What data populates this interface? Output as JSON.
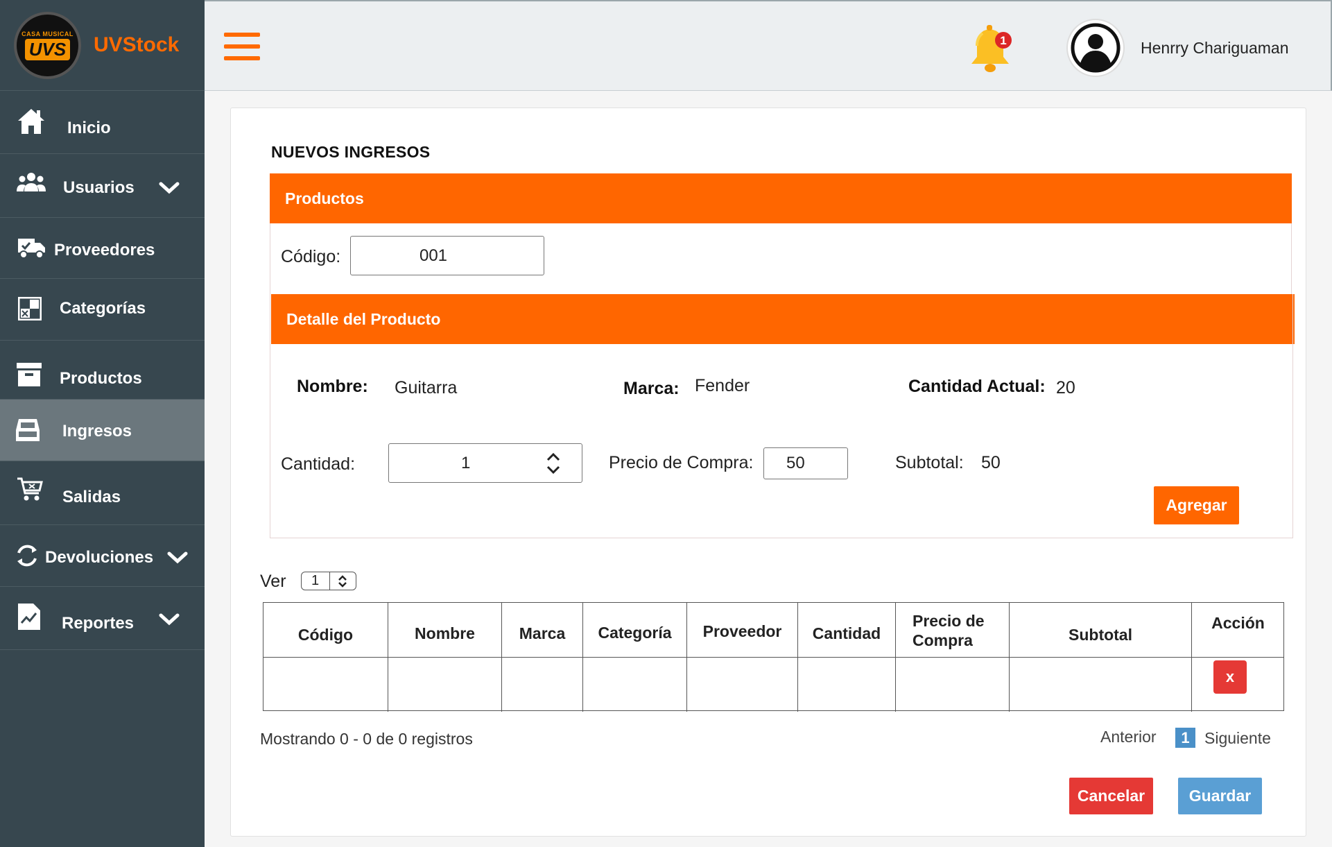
{
  "brand": {
    "logo_top": "CASA MUSICAL",
    "logo_text": "UVS",
    "name": "UVStock"
  },
  "sidebar": {
    "items": [
      {
        "label": "Inicio",
        "icon": "home-icon"
      },
      {
        "label": "Usuarios",
        "icon": "users-icon",
        "chevron": true
      },
      {
        "label": "Proveedores",
        "icon": "truck-icon"
      },
      {
        "label": "Categorías",
        "icon": "categories-icon"
      },
      {
        "label": "Productos",
        "icon": "archive-icon"
      },
      {
        "label": "Ingresos",
        "icon": "inbox-icon",
        "active": true
      },
      {
        "label": "Salidas",
        "icon": "cart-icon"
      },
      {
        "label": "Devoluciones",
        "icon": "sync-icon",
        "chevron": true
      },
      {
        "label": "Reportes",
        "icon": "report-icon",
        "chevron": true
      }
    ]
  },
  "header": {
    "notification_count": "1",
    "user_name": "Henrry Chariguaman"
  },
  "main": {
    "title": "NUEVOS INGRESOS",
    "productos_section": "Productos",
    "codigo_label": "Código:",
    "codigo_value": "001",
    "detalle_section": "Detalle del Producto",
    "nombre_label": "Nombre:",
    "nombre_value": "Guitarra",
    "marca_label": "Marca:",
    "marca_value": "Fender",
    "cantidad_actual_label": "Cantidad Actual:",
    "cantidad_actual_value": "20",
    "cantidad_label": "Cantidad:",
    "cantidad_value": "1",
    "precio_label": "Precio de Compra:",
    "precio_value": "50",
    "subtotal_label": "Subtotal:",
    "subtotal_value": "50",
    "agregar_button": "Agregar"
  },
  "table": {
    "ver_label": "Ver",
    "ver_value": "1",
    "headers": [
      "Código",
      "Nombre",
      "Marca",
      "Categoría",
      "Proveedor",
      "Cantidad",
      "Precio de Compra",
      "Subtotal",
      "Acción"
    ],
    "delete_button": "x",
    "showing": "Mostrando 0 - 0 de 0 registros",
    "prev": "Anterior",
    "page": "1",
    "next": "Siguiente"
  },
  "actions": {
    "cancel": "Cancelar",
    "save": "Guardar"
  },
  "colors": {
    "accent": "#ff6600",
    "sidebar": "#37474f",
    "danger": "#e53935",
    "primary": "#5a9fd4"
  }
}
